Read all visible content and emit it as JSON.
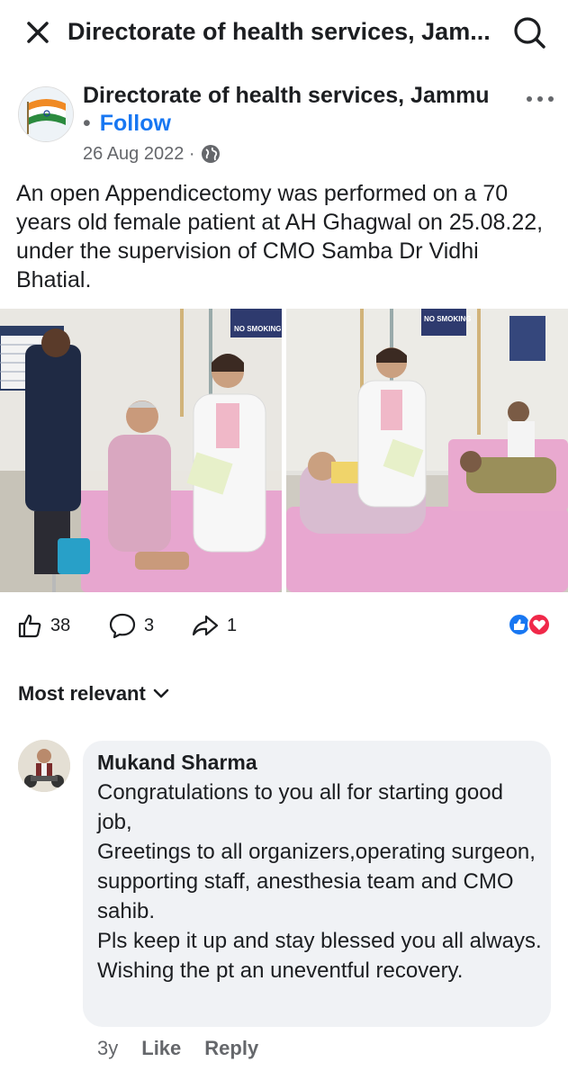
{
  "header": {
    "title": "Directorate of health services, Jam...",
    "close_icon": "close-icon",
    "search_icon": "search-icon"
  },
  "post": {
    "page_name": "Directorate of health services, Jammu",
    "follow_prefix": "•",
    "follow_label": "Follow",
    "date": "26 Aug 2022 ·",
    "privacy_icon": "globe-icon",
    "caption": "An open Appendicectomy  was performed on a 70 years old female patient at AH Ghagwal  on 25.08.22, under the supervision of CMO Samba Dr Vidhi Bhatial.",
    "photo_signs": [
      "NO SMOKING",
      "NO SMOKING"
    ],
    "reactions": {
      "like_count": "38",
      "comment_count": "3",
      "share_count": "1"
    }
  },
  "comments": {
    "sort_label": "Most relevant",
    "items": [
      {
        "author": "Mukand Sharma",
        "text": "Congratulations  to you all for starting good job,\nGreetings to all  organizers,operating surgeon, supporting  staff, anesthesia team and CMO sahib.\nPls keep it up and  stay  blessed you all always.\nWishing  the pt an uneventful recovery.",
        "time": "3y",
        "like_label": "Like",
        "reply_label": "Reply"
      }
    ]
  },
  "colors": {
    "link": "#1877f2",
    "muted": "#65676b",
    "bubble": "#f0f2f5",
    "love": "#f02849"
  }
}
